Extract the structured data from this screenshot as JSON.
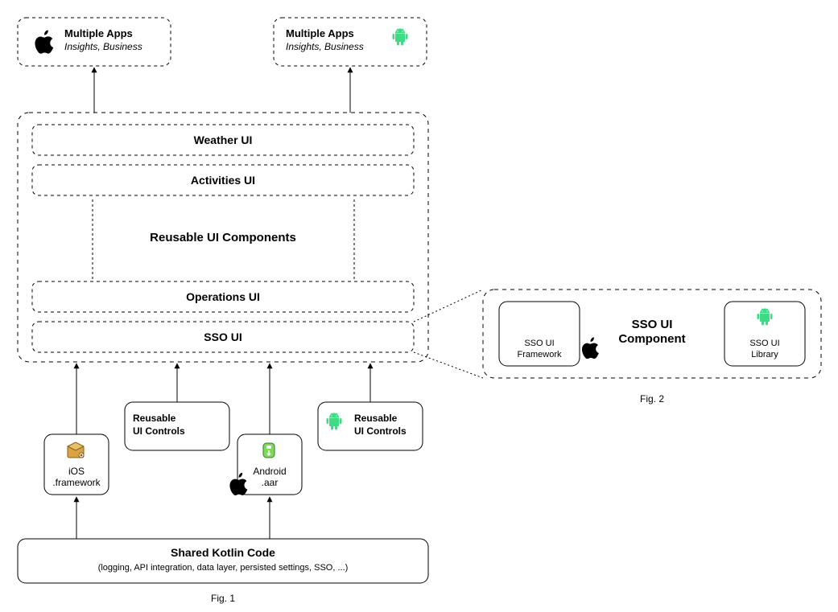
{
  "fig1": {
    "apps_ios": {
      "title": "Multiple Apps",
      "subtitle": "Insights, Business"
    },
    "apps_android": {
      "title": "Multiple Apps",
      "subtitle": "Insights, Business"
    },
    "ui_group": {
      "title": "Reusable UI Components",
      "weather": "Weather UI",
      "activities": "Activities UI",
      "operations": "Operations UI",
      "sso": "SSO UI"
    },
    "controls_ios": {
      "label1": "Reusable",
      "label2": "UI Controls"
    },
    "controls_android": {
      "label1": "Reusable",
      "label2": "UI Controls"
    },
    "ios_fw": {
      "label1": "iOS",
      "label2": ".framework"
    },
    "android_aar": {
      "label1": "Android",
      "label2": ".aar"
    },
    "shared": {
      "title": "Shared Kotlin Code",
      "subtitle": "(logging, API integration, data layer, persisted settings, SSO, ...)"
    },
    "caption": "Fig. 1"
  },
  "fig2": {
    "title": "SSO UI Component",
    "ios": {
      "label1": "SSO UI",
      "label2": "Framework"
    },
    "android": {
      "label1": "SSO UI",
      "label2": "Library"
    },
    "caption": "Fig. 2"
  }
}
